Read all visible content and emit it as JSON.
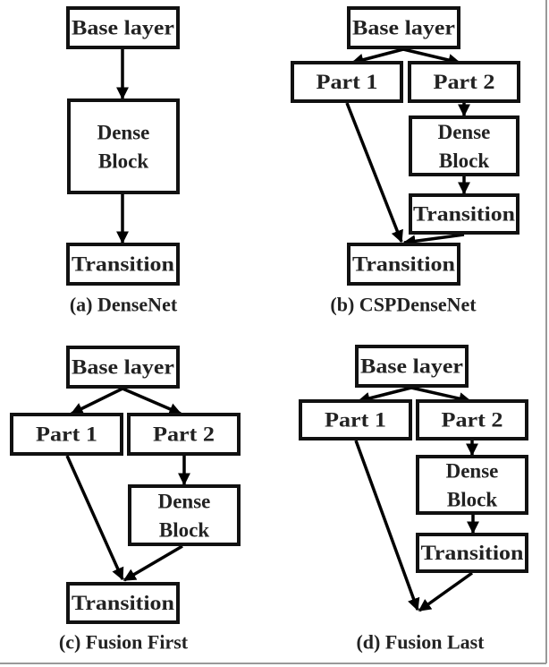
{
  "panels": [
    {
      "caption": "(a) DenseNet",
      "nodes": [
        "Base layer",
        "Dense Block",
        "Transition"
      ]
    },
    {
      "caption": "(b) CSPDenseNet",
      "nodes": [
        "Base layer",
        "Part 1",
        "Part 2",
        "Dense Block",
        "Transition",
        "Transition"
      ]
    },
    {
      "caption": "(c) Fusion First",
      "nodes": [
        "Base layer",
        "Part 1",
        "Part 2",
        "Dense Block",
        "Transition"
      ]
    },
    {
      "caption": "(d) Fusion Last",
      "nodes": [
        "Base layer",
        "Part 1",
        "Part 2",
        "Dense Block",
        "Transition"
      ]
    }
  ]
}
